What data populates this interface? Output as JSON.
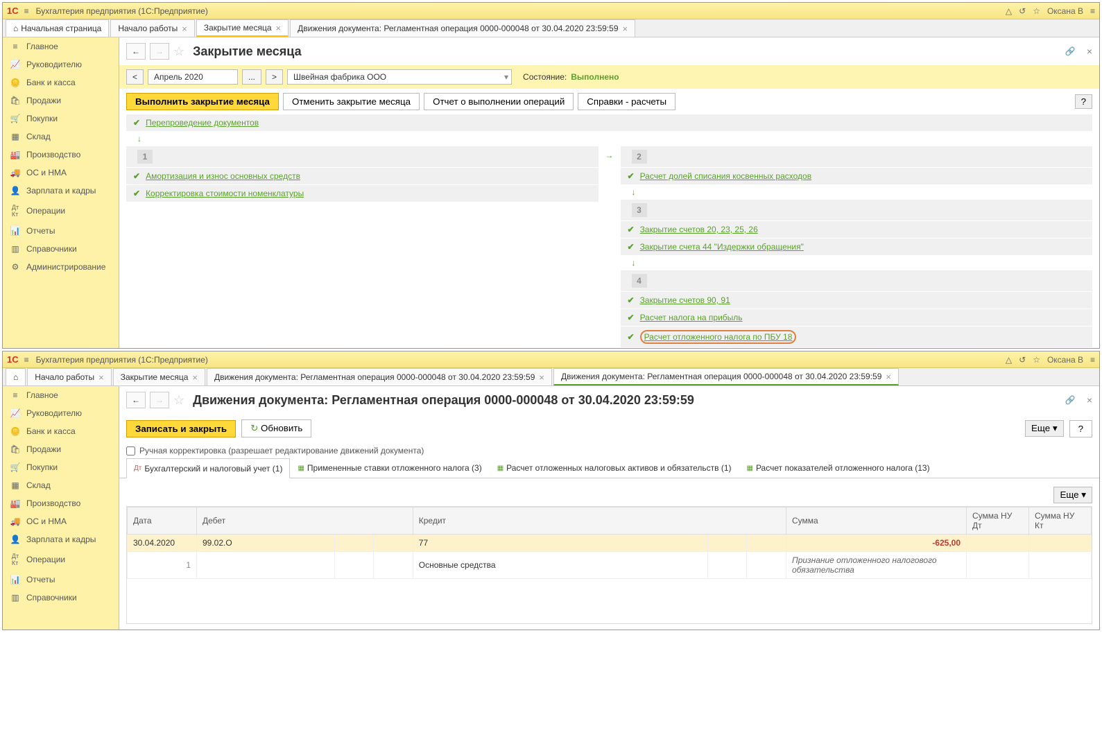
{
  "app": {
    "title": "Бухгалтерия предприятия  (1С:Предприятие)",
    "user": "Оксана В"
  },
  "tabs1": {
    "home": "Начальная страница",
    "t1": "Начало работы",
    "t2": "Закрытие месяца",
    "t3": "Движения документа: Регламентная операция 0000-000048 от 30.04.2020 23:59:59"
  },
  "sidebar": {
    "items": [
      "Главное",
      "Руководителю",
      "Банк и касса",
      "Продажи",
      "Покупки",
      "Склад",
      "Производство",
      "ОС и НМА",
      "Зарплата и кадры",
      "Операции",
      "Отчеты",
      "Справочники",
      "Администрирование"
    ]
  },
  "page1": {
    "title": "Закрытие месяца",
    "period": "Апрель 2020",
    "org": "Швейная фабрика ООО",
    "status_lbl": "Состояние:",
    "status_val": "Выполнено",
    "btn_run": "Выполнить закрытие месяца",
    "btn_cancel": "Отменить закрытие месяца",
    "btn_report": "Отчет о выполнении операций",
    "btn_ref": "Справки - расчеты",
    "op_repost": "Перепроведение документов",
    "col1": {
      "op1": "Амортизация и износ основных средств",
      "op2": "Корректировка стоимости номенклатуры"
    },
    "col2": {
      "s2op1": "Расчет долей списания косвенных расходов",
      "s3op1": "Закрытие счетов 20, 23, 25, 26",
      "s3op2": "Закрытие счета 44 \"Издержки обращения\"",
      "s4op1": "Закрытие счетов 90, 91",
      "s4op2": "Расчет налога на прибыль",
      "s4op3": "Расчет отложенного налога по ПБУ 18"
    }
  },
  "tabs2": {
    "t1": "Начало работы",
    "t2": "Закрытие месяца",
    "t3": "Движения документа: Регламентная операция 0000-000048 от 30.04.2020 23:59:59",
    "t4": "Движения документа: Регламентная операция 0000-000048 от 30.04.2020 23:59:59"
  },
  "page2": {
    "title": "Движения документа: Регламентная операция 0000-000048 от 30.04.2020 23:59:59",
    "btn_save": "Записать и закрыть",
    "btn_refresh": "Обновить",
    "btn_more": "Еще",
    "chk_label": "Ручная корректировка (разрешает редактирование движений документа)",
    "itab1": "Бухгалтерский и налоговый учет (1)",
    "itab2": "Примененные ставки отложенного налога (3)",
    "itab3": "Расчет отложенных налоговых активов и обязательств (1)",
    "itab4": "Расчет показателей отложенного налога (13)",
    "cols": {
      "date": "Дата",
      "debit": "Дебет",
      "credit": "Кредит",
      "sum": "Сумма",
      "nudt": "Сумма НУ Дт",
      "nukt": "Сумма НУ Кт"
    },
    "row1": {
      "date": "30.04.2020",
      "n": "1",
      "debit": "99.02.О",
      "credit": "77",
      "sum": "-625,00",
      "desc_credit": "Основные средства",
      "desc_sum": "Признание отложенного налогового обязательства"
    }
  }
}
